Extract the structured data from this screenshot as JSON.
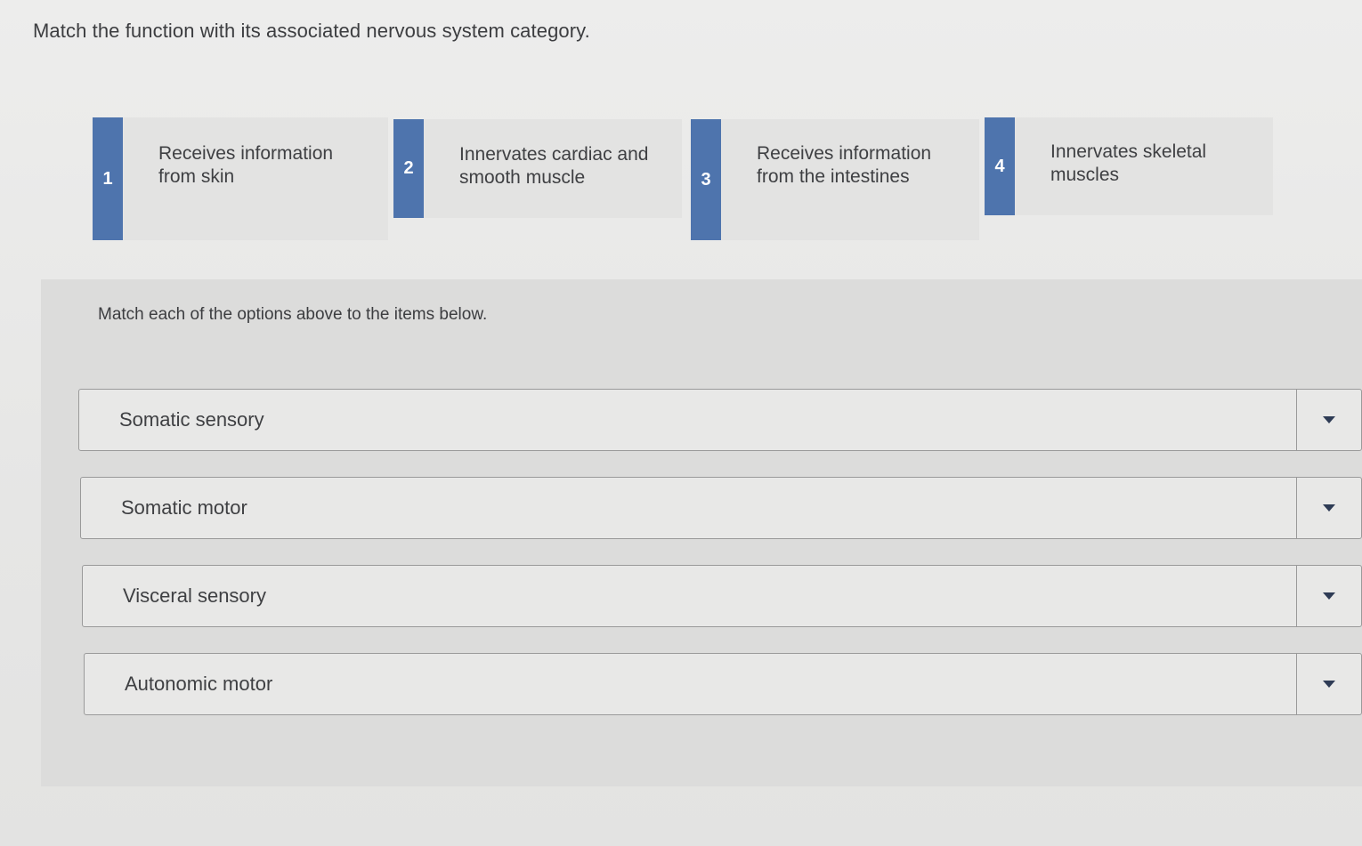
{
  "question": "Match the function with its associated nervous system category.",
  "options": [
    {
      "number": "1",
      "text": "Receives information from skin"
    },
    {
      "number": "2",
      "text": "Innervates cardiac and smooth muscle"
    },
    {
      "number": "3",
      "text": "Receives information from the intestines"
    },
    {
      "number": "4",
      "text": "Innervates skeletal muscles"
    }
  ],
  "match": {
    "instruction": "Match each of the options above to the items below.",
    "items": [
      {
        "label": "Somatic sensory",
        "dropdown_icon": "chevron-down-icon"
      },
      {
        "label": "Somatic motor",
        "dropdown_icon": "chevron-down-icon"
      },
      {
        "label": "Visceral sensory",
        "dropdown_icon": "chevron-down-icon"
      },
      {
        "label": "Autonomic motor",
        "dropdown_icon": "chevron-down-icon"
      }
    ]
  },
  "colors": {
    "accent": "#4e74ad",
    "panel": "#dcdcdb",
    "background": "#e9e9e8"
  }
}
